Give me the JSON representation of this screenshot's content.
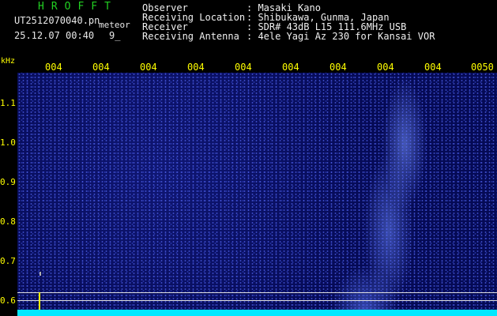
{
  "header": {
    "logo": "HROFFT",
    "filename": "UT2512070040.pn",
    "tag": "meteor",
    "timestamp": "25.12.07 00:40",
    "page": "9_",
    "info": [
      {
        "key": "Observer",
        "value": ": Masaki Kano"
      },
      {
        "key": "Receiving Location",
        "value": ": Shibukawa, Gunma, Japan"
      },
      {
        "key": "Receiver",
        "value": ": SDR# 43dB L15 111.6MHz USB"
      },
      {
        "key": "Receiving Antenna",
        "value": ": 4ele Yagi Az 230 for Kansai VOR"
      }
    ]
  },
  "x_ticks": [
    "004",
    "004",
    "004",
    "004",
    "004",
    "004",
    "004",
    "004",
    "004",
    "0050"
  ],
  "y_axis": {
    "unit": "kHz",
    "ticks": [
      "1.1",
      "1.0",
      "0.9",
      "0.8",
      "0.7",
      "0.6"
    ]
  }
}
